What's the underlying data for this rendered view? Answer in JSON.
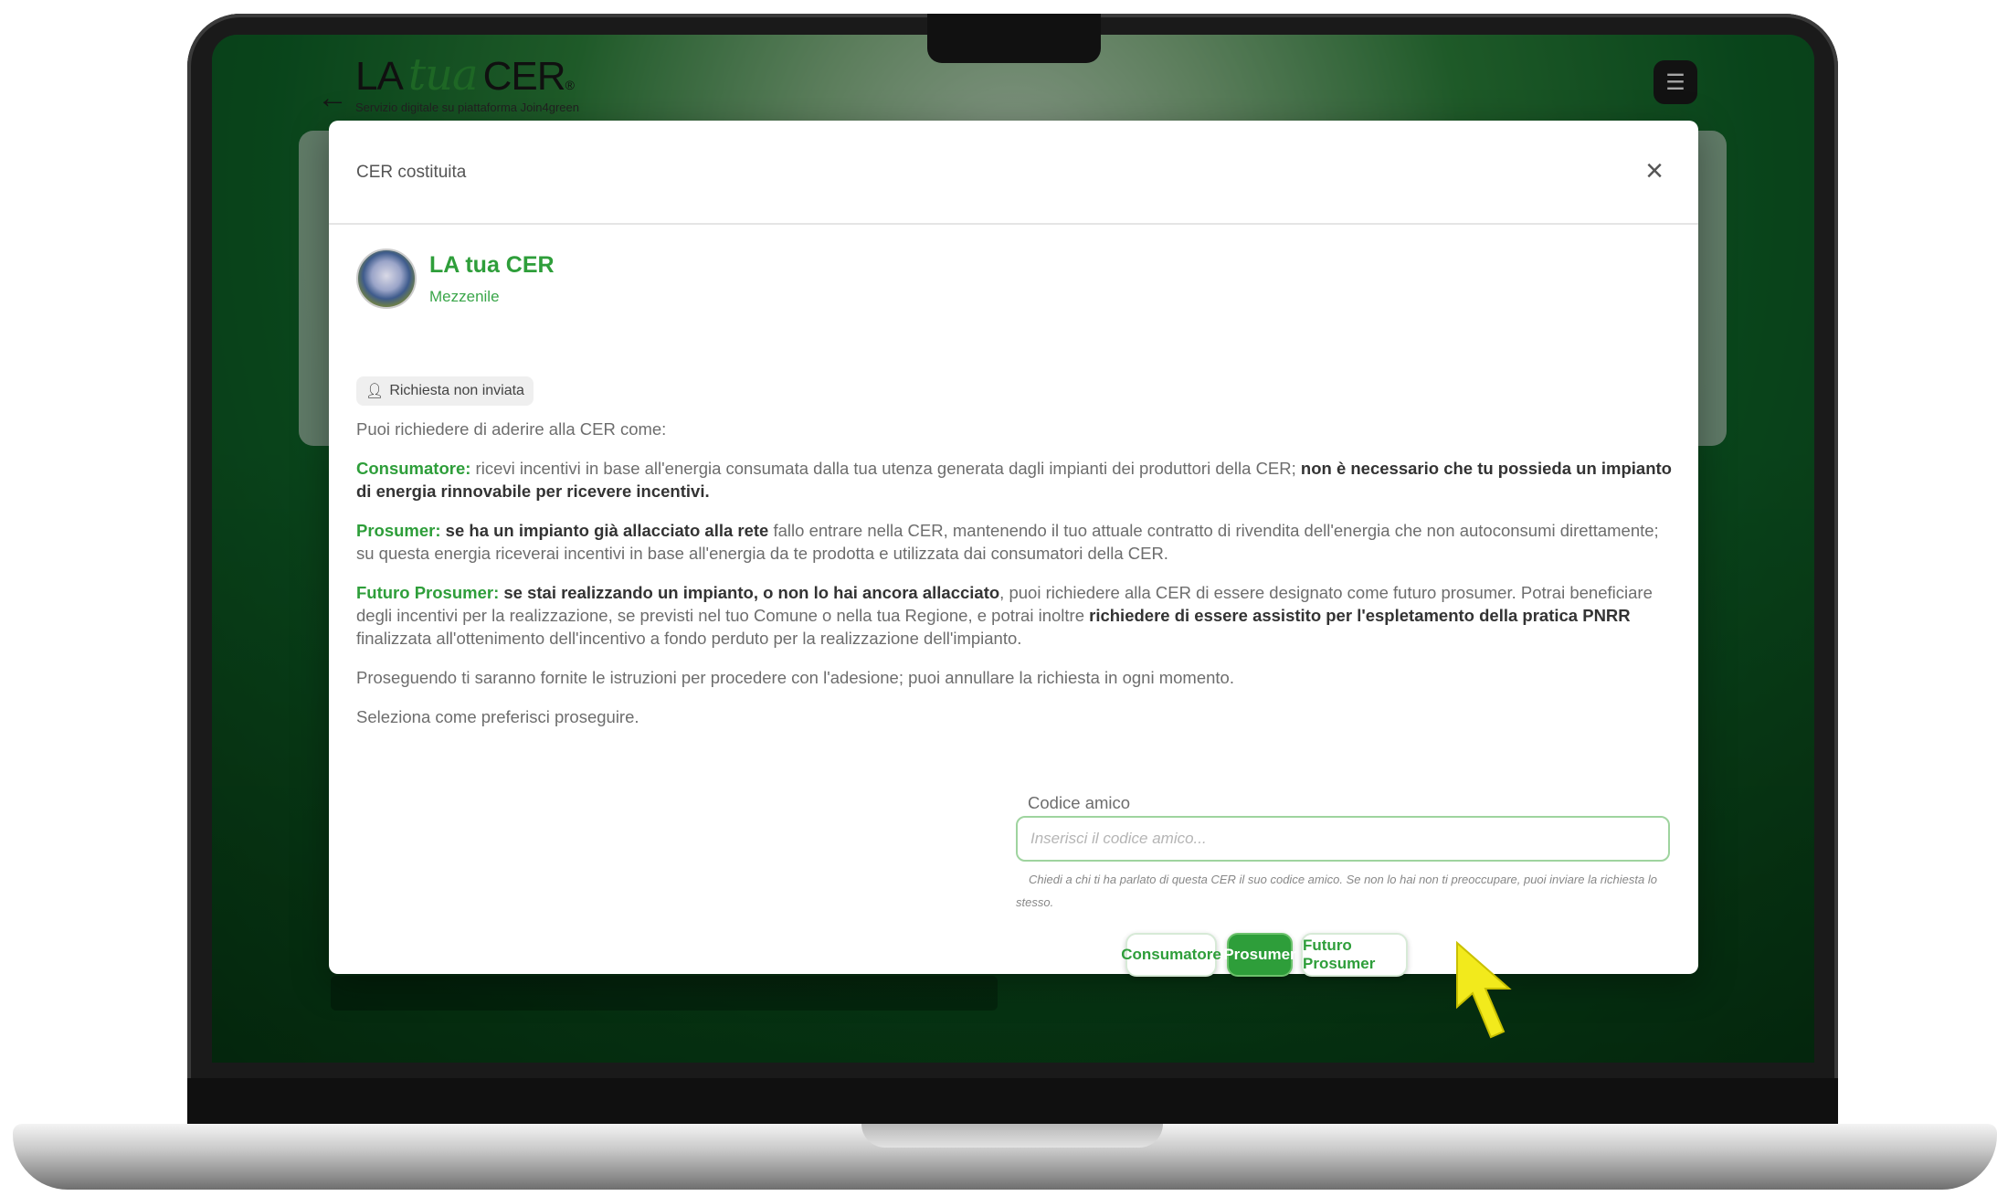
{
  "app": {
    "back_glyph": "←",
    "logo_left": "LA",
    "logo_tua": "tua",
    "logo_right": "CER",
    "logo_reg": "®",
    "logo_subtitle": "Servizio digitale su piattaforma Join4green",
    "menu_icon": "menu-icon"
  },
  "modal": {
    "title": "CER costituita",
    "close_glyph": "×",
    "cer_name": "LA tua CER",
    "cer_place": "Mezzenile",
    "status_badge": "Richiesta non inviata",
    "intro": "Puoi richiedere di aderire alla CER come:",
    "consumatore": {
      "term": "Consumatore:",
      "text": " ricevi incentivi in base all'energia consumata dalla tua utenza generata dagli impianti dei produttori della CER; ",
      "bold": "non è necessario che tu possieda un impianto di energia rinnovabile per ricevere incentivi."
    },
    "prosumer": {
      "term": "Prosumer:",
      "bold": " se ha un impianto già allacciato alla rete",
      "text": " fallo entrare nella CER, mantenendo il tuo attuale contratto di rivendita dell'energia che non autoconsumi direttamente; su questa energia riceverai incentivi in base all'energia da te prodotta e utilizzata dai consumatori della CER."
    },
    "futuro": {
      "term": "Futuro Prosumer:",
      "bold1": " se stai realizzando un impianto, o non lo hai ancora allacciato",
      "text1": ", puoi richiedere alla CER di essere designato come futuro prosumer. Potrai beneficiare degli incentivi per la realizzazione, se previsti nel tuo Comune o nella tua Regione, e potrai inoltre ",
      "bold2": "richiedere di essere assistito per l'espletamento della pratica PNRR",
      "text2": " finalizzata all'ottenimento dell'incentivo a fondo perduto per la realizzazione dell'impianto."
    },
    "proseguendo": "Proseguendo ti saranno fornite le istruzioni per procedere con l'adesione; puoi annullare la richiesta in ogni momento.",
    "seleziona": "Seleziona come preferisci proseguire.",
    "codice_label": "Codice amico",
    "codice_placeholder": "Inserisci il codice amico...",
    "codice_help": "Chiedi a chi ti ha parlato di questa CER il suo codice amico. Se non lo hai non ti preoccupare, puoi inviare la richiesta lo stesso.",
    "buttons": {
      "consumatore": "Consumatore",
      "prosumer": "Prosumer",
      "futuro_prosumer": "Futuro Prosumer"
    }
  },
  "colors": {
    "brand_green": "#2e9e3a",
    "cursor_yellow": "#f2ea1c"
  }
}
